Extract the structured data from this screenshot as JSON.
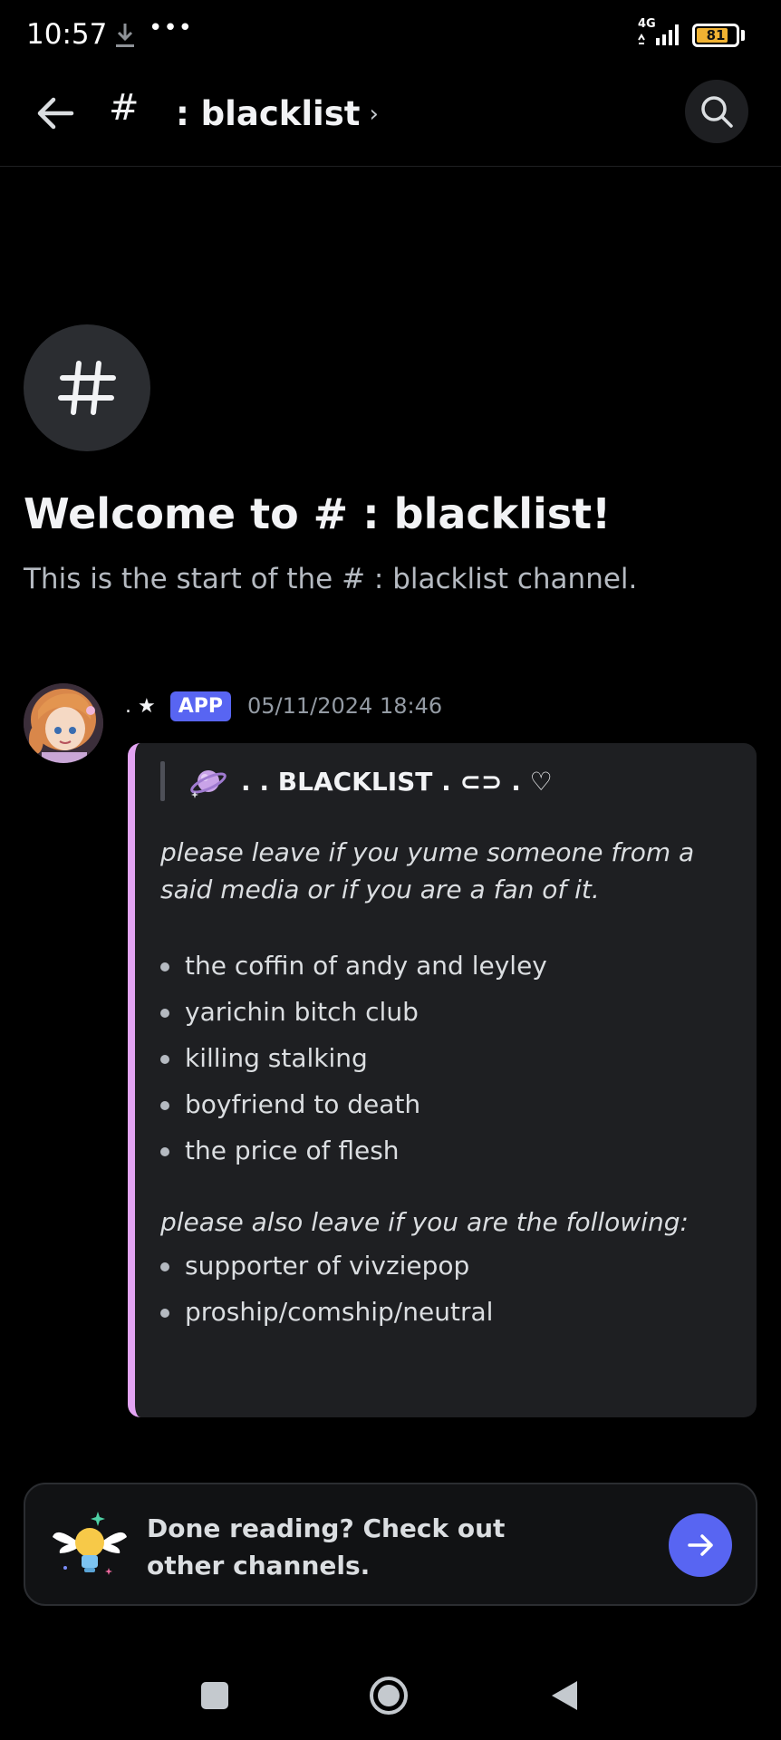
{
  "status_bar": {
    "time": "10:57",
    "more": "•••",
    "network": "4G",
    "battery": "81",
    "battery_level": 0.81,
    "icons": [
      "download-icon",
      "signal-icon",
      "battery-icon"
    ]
  },
  "header": {
    "hash": "#",
    "channel_name": ": blacklist",
    "chevron": "›",
    "icons": [
      "back-arrow-icon",
      "search-icon"
    ]
  },
  "welcome": {
    "icon": "#",
    "title": "Welcome to # : blacklist!",
    "subtitle": "This is the start of the # : blacklist channel."
  },
  "message": {
    "author": ". ★",
    "badge": "APP",
    "timestamp": "05/11/2024 18:46",
    "embed": {
      "accent_color": "#e3a4f3",
      "title_icon": "planet-icon",
      "title": ". . BLACKLIST . ⊂⊃ . ♡",
      "intro": "please leave if you yume someone from a said media or if you are a fan of it.",
      "media_list": [
        "the coffin of andy and leyley",
        "yarichin bitch club",
        "killing stalking",
        "boyfriend to death",
        "the price of flesh"
      ],
      "also_text": "please also leave if you are the following:",
      "also_list": [
        "supporter of vivziepop",
        "proship/comship/neutral"
      ]
    }
  },
  "done_card": {
    "text": "Done reading? Check out other channels.",
    "icons": [
      "winged-lightbulb-icon",
      "arrow-right-icon"
    ]
  },
  "nav_bar": {
    "icons": [
      "recents-square-icon",
      "home-circle-icon",
      "back-triangle-icon"
    ]
  },
  "colors": {
    "background": "#000000",
    "accent": "#5865f2",
    "embed_bg": "#1e1f22",
    "embed_border": "#e3a4f3",
    "battery": "#f0b232"
  }
}
